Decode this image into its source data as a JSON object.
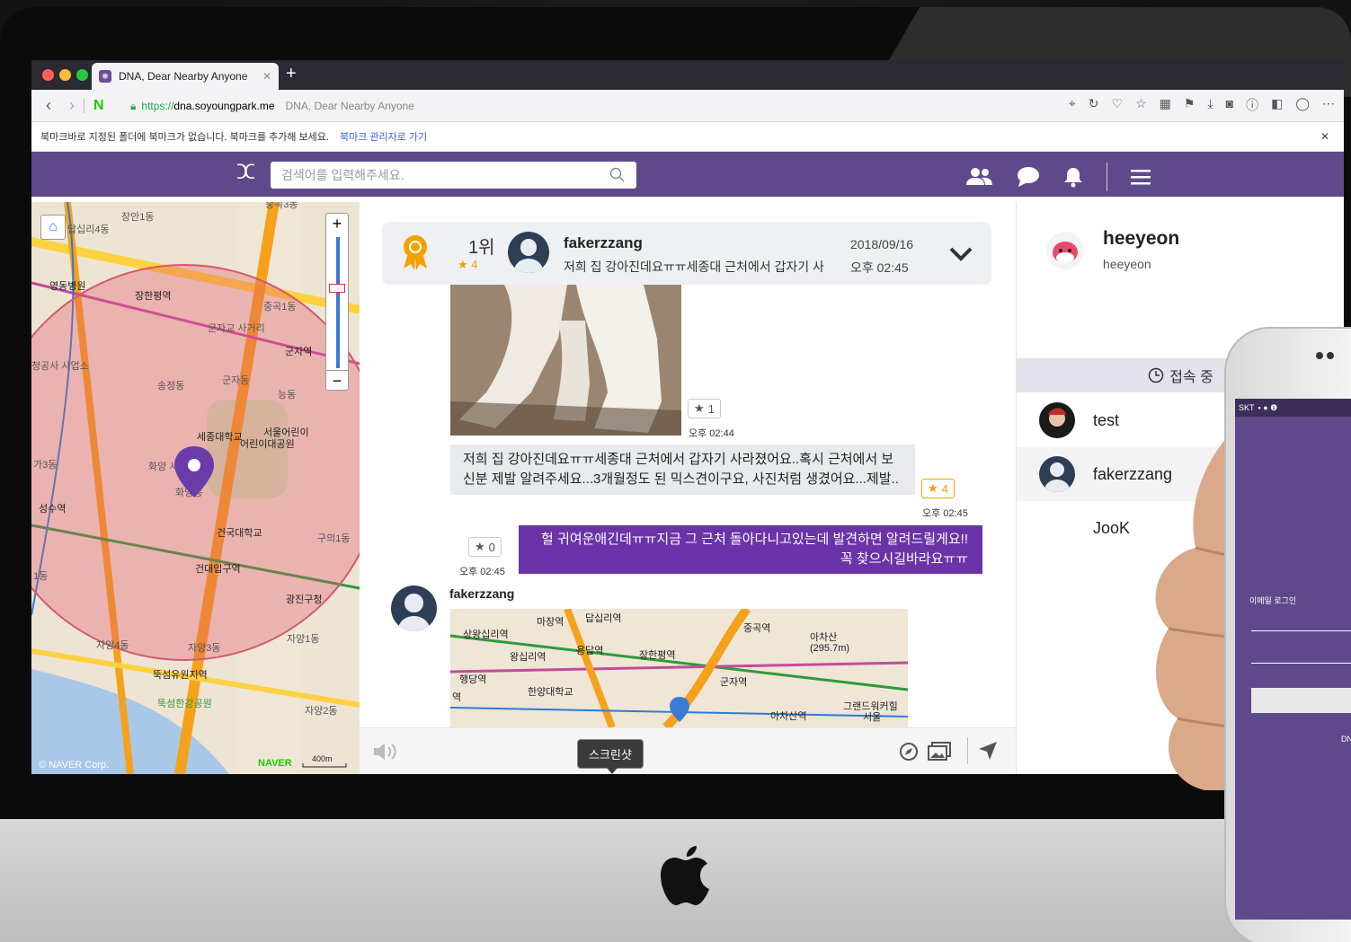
{
  "browser": {
    "tab_title": "DNA, Dear Nearby Anyone",
    "tab_icon": "dna-favicon-icon",
    "url_scheme": "https://",
    "url_host": "dna.soyoungpark.me",
    "url_page_title": "DNA, Dear Nearby Anyone",
    "bookmark_notice": "북마크바로 지정된 폴더에 북마크가 없습니다. 북마크를 추가해 보세요.",
    "bookmark_link": "북마크 관리자로 가기"
  },
  "site": {
    "search_placeholder": "검색어를 입력해주세요.",
    "brand_color": "#5e4a8a"
  },
  "map": {
    "labels": [
      "장안1동",
      "답십리4동",
      "중곡3동",
      "영동병원",
      "장한평역",
      "중곡1동",
      "군자교 사거리",
      "군자역",
      "능동",
      "송정동",
      "군자동",
      "세종대학교",
      "서울어린이 대공원",
      "어린이대공원",
      "화양 사거리",
      "화양동",
      "성수역",
      "건국대학교",
      "구의1동",
      "건대입구역",
      "광진구청",
      "자양4동",
      "자양3동",
      "자양1동",
      "뚝섬유원지역",
      "뚝섬한강공원",
      "자양2동",
      "가3동",
      "1동",
      "청공사 사업소"
    ],
    "scale": "400m",
    "copyright": "© NAVER Corp.",
    "naver": "NAVER"
  },
  "rank_card": {
    "rank": "1위",
    "stars": "4",
    "username": "fakerzzang",
    "preview": "저희 집 강아진데요ㅠㅠ세종대 근처에서 갑자기 사",
    "date": "2018/09/16",
    "time": "오후 02:45"
  },
  "messages": {
    "photo_stars": "1",
    "photo_time": "오후 02:44",
    "text1": "저희 집 강아진데요ㅠㅠ세종대 근처에서 갑자기 사라졌어요..혹시 근처에서 보신분 제발 알려주세요...3개월정도 된 믹스견이구요, 사진처럼 생겼어요...제발..",
    "text1_stars": "4",
    "text1_time": "오후 02:45",
    "reply": "헐 귀여운애긴데ㅠㅠ지금 그 근처 돌아다니고있는데 발견하면 알려드릴게요!!꼭 찾으시길바라요ㅠㅠ",
    "reply_stars": "0",
    "reply_time": "오후 02:45",
    "map_user": "fakerzzang",
    "map_labels": [
      "마장역",
      "답십리역",
      "중곡역",
      "상왕십리역",
      "왕십리역",
      "용답역",
      "장한평역",
      "아차산 (295.7m)",
      "행당역",
      "한양대학교",
      "군자역",
      "아차산역",
      "그랜드워커힐 서울",
      "역"
    ]
  },
  "compose": {
    "tooltip": "스크린샷"
  },
  "side": {
    "profile_name": "heeyeon",
    "profile_id": "heeyeon",
    "online_label": "접속 중",
    "users": [
      "test",
      "fakerzzang",
      "JooK"
    ]
  },
  "phone": {
    "carrier": "SKT",
    "login_label": "이메일 로그인",
    "footer": "DN"
  }
}
